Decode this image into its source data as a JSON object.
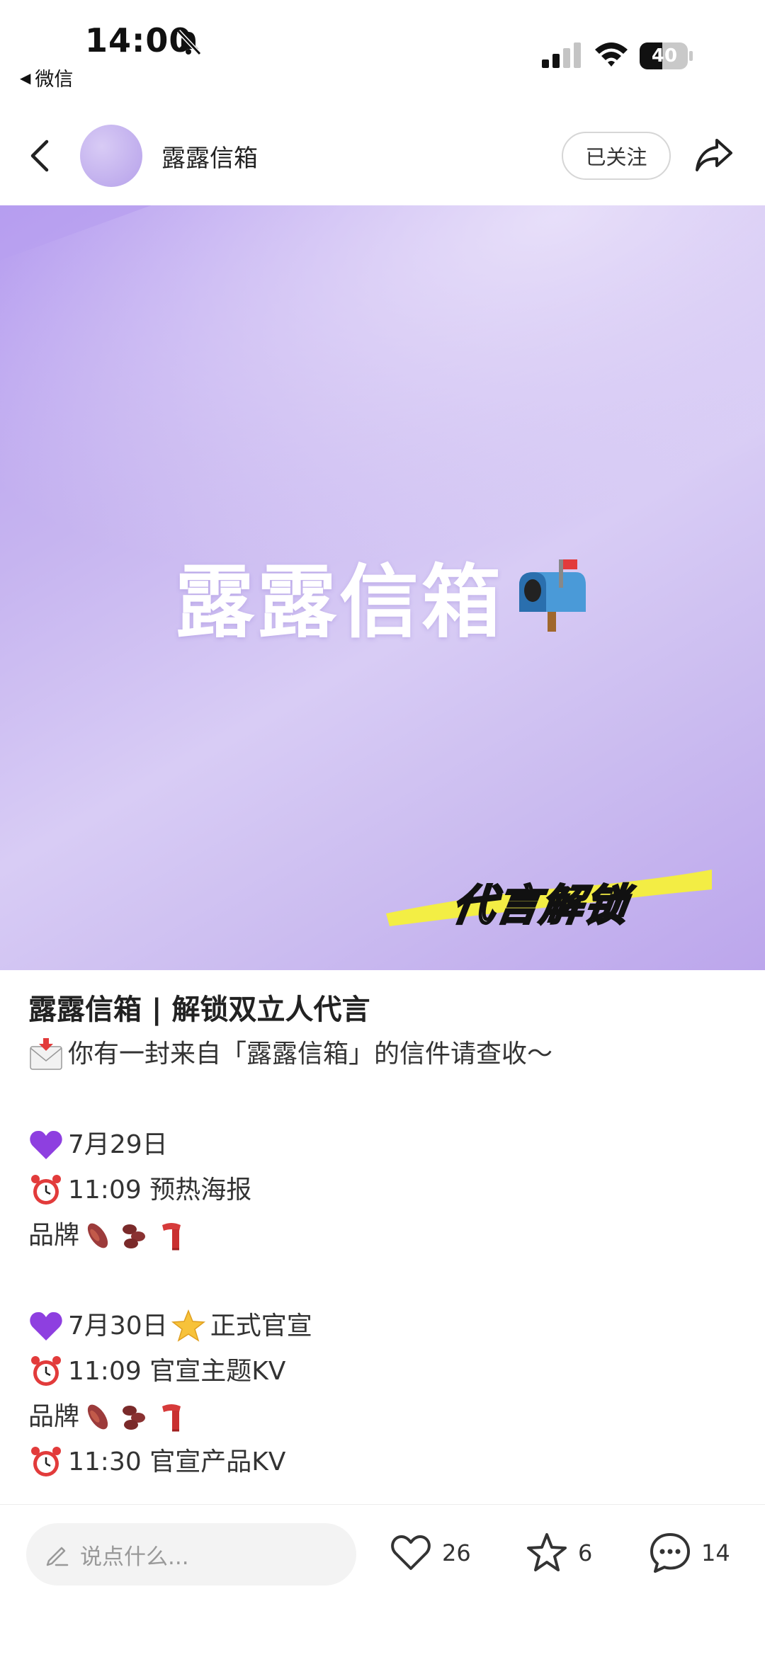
{
  "status_bar": {
    "time": "14:00",
    "back_app": "微信",
    "battery_level": "40"
  },
  "nav": {
    "author_name": "露露信箱",
    "follow_label": "已关注"
  },
  "cover": {
    "title": "露露信箱",
    "tag": "代言解锁"
  },
  "post": {
    "title": "露露信箱 | 解锁双立人代言",
    "line_intro": "你有一封来自「露露信箱」的信件请查收～",
    "line_date1": "7月29日",
    "line_time1": "11:09 预热海报",
    "line_brand1": "品牌",
    "line_date2": "7月30日",
    "line_official": "正式官宣",
    "line_time2": "11:09 官宣主题KV",
    "line_brand2": "品牌",
    "line_time3": "11:30 官宣产品KV"
  },
  "bottom_bar": {
    "comment_placeholder": "说点什么...",
    "likes": "26",
    "favorites": "6",
    "comments": "14"
  },
  "colors": {
    "cover_purple": "#c6b4f0",
    "highlight_yellow": "#f5f03a",
    "heart_purple": "#8e3fe0"
  }
}
